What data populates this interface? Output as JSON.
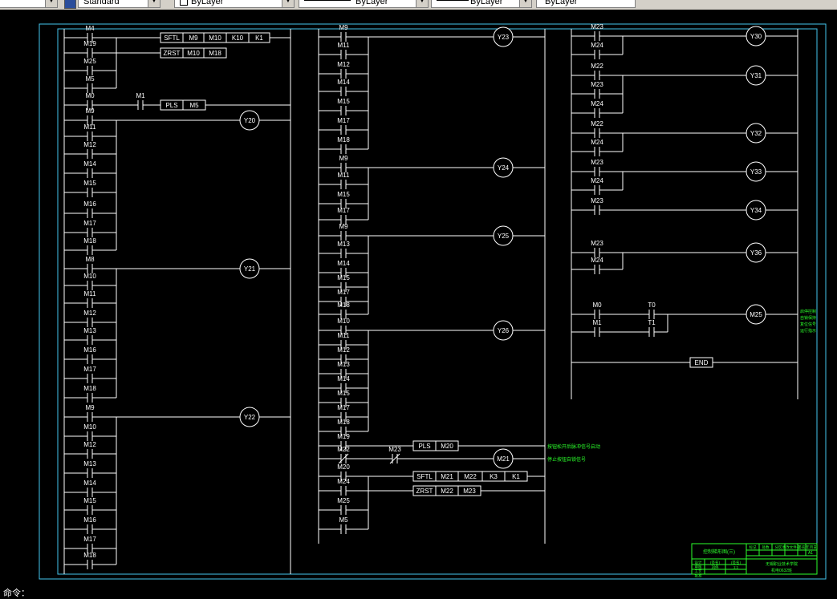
{
  "toolbar": {
    "text_style": "Standard",
    "layer": "ByLayer",
    "linetype": "ByLayer",
    "lineweight": "ByLayer",
    "plotstyle": "ByLayer"
  },
  "ladder": {
    "col1": {
      "r1": {
        "contacts": [
          "M4",
          "M19",
          "M25",
          "M5"
        ],
        "box1": [
          "SFTL",
          "M9",
          "M10",
          "K10",
          "K1"
        ],
        "box2": [
          "ZRST",
          "M10",
          "M18"
        ]
      },
      "r2": {
        "contacts": [
          "M0"
        ],
        "series": "M1",
        "box": [
          "PLS",
          "M5"
        ]
      },
      "r3": {
        "contacts": [
          "M9",
          "M11",
          "M12",
          "M14",
          "M15",
          "M16",
          "M17",
          "M18"
        ],
        "coil": "Y20"
      },
      "r4": {
        "contacts": [
          "M8",
          "M10",
          "M11",
          "M12",
          "M13",
          "M16",
          "M17",
          "M18"
        ],
        "coil": "Y21"
      },
      "r5": {
        "contacts": [
          "M9",
          "M10",
          "M12",
          "M13",
          "M14",
          "M15",
          "M16",
          "M17",
          "M18"
        ],
        "coil": "Y22"
      }
    },
    "col2": {
      "r1": {
        "contacts": [
          "M9",
          "M11",
          "M12",
          "M14",
          "M15",
          "M17",
          "M18"
        ],
        "coil": "Y23"
      },
      "r2": {
        "contacts": [
          "M9",
          "M11",
          "M15",
          "M17"
        ],
        "coil": "Y24"
      },
      "r3": {
        "contacts": [
          "M9",
          "M13",
          "M14",
          "M15",
          "M17",
          "M18"
        ],
        "coil": "Y25"
      },
      "r4": {
        "contacts": [
          "M10",
          "M11",
          "M12",
          "M13",
          "M14",
          "M15",
          "M17",
          "M18"
        ],
        "coil": "Y26"
      },
      "r5": {
        "contact": "M19",
        "box": [
          "PLS",
          "M20"
        ],
        "note": "按钮松开后脉冲信号启动"
      },
      "r6": {
        "contact": "M22",
        "series": "M23",
        "coil": "M21",
        "note": "停止按钮自锁信号"
      },
      "r7": {
        "contacts": [
          "M20",
          "M24"
        ],
        "box": [
          "SFTL",
          "M21",
          "M22",
          "K3",
          "K1"
        ]
      },
      "r8": {
        "contacts": [
          "M25",
          "M5"
        ],
        "box": [
          "ZRST",
          "M22",
          "M23"
        ]
      }
    },
    "col3": {
      "r1": {
        "contacts": [
          "M23",
          "M24"
        ],
        "coil": "Y30"
      },
      "r2": {
        "contacts": [
          "M22",
          "M23",
          "M24"
        ],
        "coil": "Y31"
      },
      "r3": {
        "contacts": [
          "M22",
          "M24"
        ],
        "coil": "Y32"
      },
      "r4": {
        "contacts": [
          "M23",
          "M24"
        ],
        "coil": "Y33"
      },
      "r5": {
        "contacts": [
          "M23"
        ],
        "coil": "Y34"
      },
      "r6": {
        "contacts": [
          "M23",
          "M24"
        ],
        "coil": "Y36"
      },
      "r7": {
        "row1": [
          "M0",
          "T0"
        ],
        "row2": [
          "M1",
          "T1"
        ],
        "coil": "M25",
        "note": [
          "启停控制",
          "自锁保持",
          "复位信号",
          "运行指示"
        ]
      },
      "end": "END"
    }
  },
  "title_block": {
    "title": "控制梯形图(三)",
    "fields": [
      "标记",
      "处数",
      "分区",
      "更改文件号",
      "签名",
      "年月日"
    ],
    "rows": [
      "设计",
      "审核",
      "工艺",
      "批准"
    ],
    "values": [
      "(签名)",
      "(签名)",
      "标准化",
      "阶段标记",
      "重量",
      "比例"
    ],
    "school": "无锡职业技术学院",
    "class": "机电0632班",
    "sheet": "A1",
    "scale": "1:1",
    "name": "刘伟"
  },
  "command_line": "命令：",
  "colors": {
    "line": "#ffffff",
    "frame": "#44c6ee",
    "note": "#2bff2b",
    "bg": "#000000"
  }
}
